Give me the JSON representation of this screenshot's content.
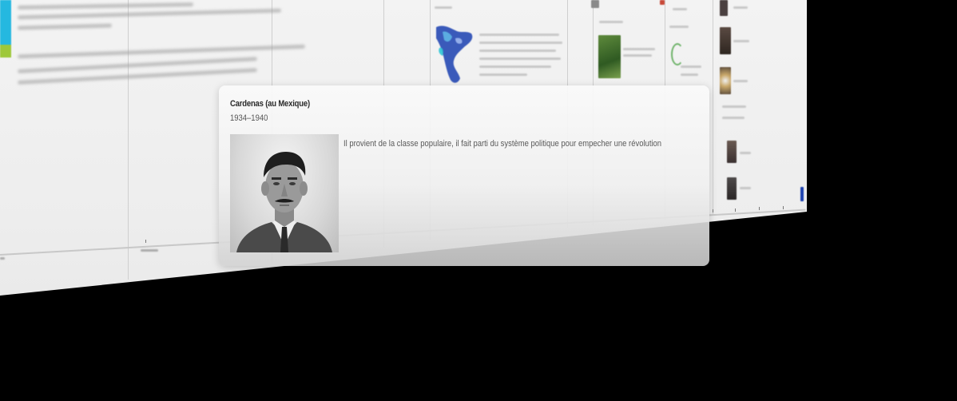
{
  "event": {
    "title": "Cardenas (au Mexique)",
    "dates": "1934–1940",
    "description": "Il provient de la classe populaire, il fait parti du système politique pour empecher une révolution",
    "photo": "portrait-photo"
  },
  "background": {
    "view": "timeline-3d-wall",
    "accent_colors": [
      "#25b8e0",
      "#9ec83a",
      "#1a3fb0"
    ]
  }
}
